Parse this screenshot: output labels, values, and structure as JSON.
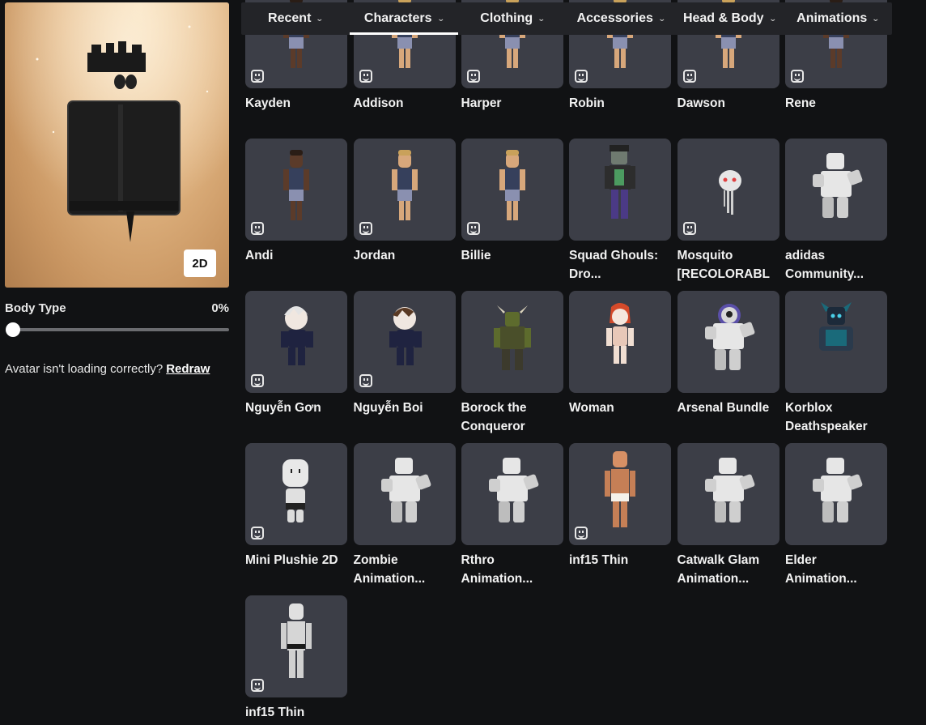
{
  "preview": {
    "toggle_label": "2D"
  },
  "body_type": {
    "label": "Body Type",
    "value": "0%",
    "slider_fraction": 0.0
  },
  "redraw": {
    "message": "Avatar isn't loading correctly?",
    "link_label": "Redraw"
  },
  "tabs": [
    {
      "label": "Recent",
      "active": false
    },
    {
      "label": "Characters",
      "active": true
    },
    {
      "label": "Clothing",
      "active": false
    },
    {
      "label": "Accessories",
      "active": false
    },
    {
      "label": "Head & Body",
      "active": false
    },
    {
      "label": "Animations",
      "active": false
    }
  ],
  "items": [
    {
      "name": "Kayden",
      "badge": true,
      "figure": "dark-skin-kid"
    },
    {
      "name": "Addison",
      "badge": true,
      "figure": "light-skin-kid"
    },
    {
      "name": "Harper",
      "badge": true,
      "figure": "light-skin-kid"
    },
    {
      "name": "Robin",
      "badge": true,
      "figure": "light-skin-kid"
    },
    {
      "name": "Dawson",
      "badge": true,
      "figure": "light-skin-kid"
    },
    {
      "name": "Rene",
      "badge": true,
      "figure": "dark-skin-kid"
    },
    {
      "name": "Andi",
      "badge": true,
      "figure": "dark-skin-kid"
    },
    {
      "name": "Jordan",
      "badge": true,
      "figure": "light-skin-kid"
    },
    {
      "name": "Billie",
      "badge": true,
      "figure": "light-skin-kid"
    },
    {
      "name": "Squad Ghouls: Dro...",
      "badge": false,
      "figure": "ghoul"
    },
    {
      "name": "Mosquito [RECOLORABL",
      "badge": true,
      "figure": "mosquito"
    },
    {
      "name": "adidas Community...",
      "badge": false,
      "figure": "grey-block"
    },
    {
      "name": "Nguyễn Gơn",
      "badge": true,
      "figure": "anime-white-hair"
    },
    {
      "name": "Nguyễn Boi",
      "badge": true,
      "figure": "anime-brown-hair"
    },
    {
      "name": "Borock the Conqueror",
      "badge": false,
      "figure": "orc"
    },
    {
      "name": "Woman",
      "badge": false,
      "figure": "woman"
    },
    {
      "name": "Arsenal Bundle",
      "badge": false,
      "figure": "hooded-block"
    },
    {
      "name": "Korblox Deathspeaker",
      "badge": false,
      "figure": "korblox"
    },
    {
      "name": "Mini Plushie 2D",
      "badge": true,
      "figure": "plushie"
    },
    {
      "name": "Zombie Animation...",
      "badge": false,
      "figure": "grey-block"
    },
    {
      "name": "Rthro Animation...",
      "badge": false,
      "figure": "grey-block"
    },
    {
      "name": "inf15 Thin",
      "badge": true,
      "figure": "tan-thin"
    },
    {
      "name": "Catwalk Glam Animation...",
      "badge": false,
      "figure": "grey-block"
    },
    {
      "name": "Elder Animation...",
      "badge": false,
      "figure": "grey-block"
    },
    {
      "name": "inf15 Thin",
      "badge": true,
      "figure": "grey-thin"
    }
  ],
  "colors": {
    "page_bg": "#111214",
    "card_bg": "#3c3e47",
    "tabbar_bg": "#232428",
    "preview_bg": "#e4b986"
  }
}
